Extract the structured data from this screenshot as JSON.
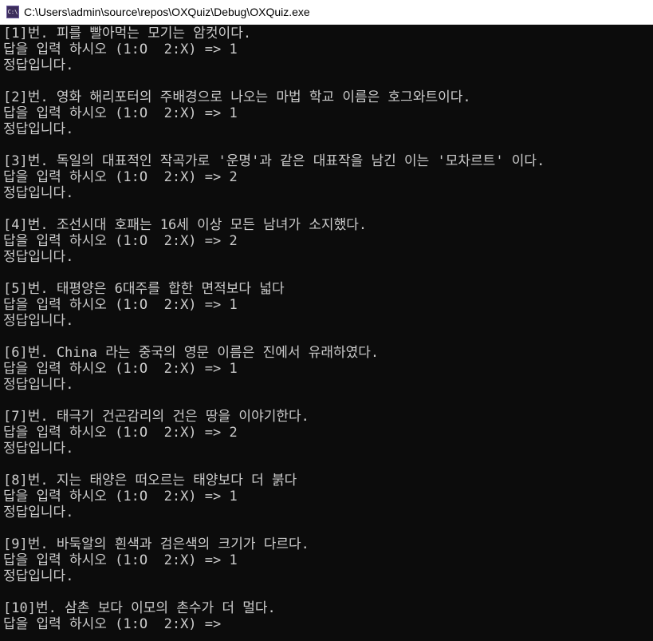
{
  "window": {
    "title": "C:\\Users\\admin\\source\\repos\\OXQuiz\\Debug\\OXQuiz.exe",
    "icon": "console-app-icon",
    "icon_glyph": "C:\\"
  },
  "console": {
    "colors": {
      "background": "#0c0c0c",
      "text": "#cccccc"
    },
    "blocks": [
      {
        "question": "[1]번. 피를 빨아먹는 모기는 암컷이다.",
        "prompt": "답을 입력 하시오 (1:O  2:X) => 1",
        "result": "정답입니다."
      },
      {
        "question": "[2]번. 영화 해리포터의 주배경으로 나오는 마법 학교 이름은 호그와트이다.",
        "prompt": "답을 입력 하시오 (1:O  2:X) => 1",
        "result": "정답입니다."
      },
      {
        "question": "[3]번. 독일의 대표적인 작곡가로 '운명'과 같은 대표작을 남긴 이는 '모차르트' 이다.",
        "prompt": "답을 입력 하시오 (1:O  2:X) => 2",
        "result": "정답입니다."
      },
      {
        "question": "[4]번. 조선시대 호패는 16세 이상 모든 남녀가 소지했다.",
        "prompt": "답을 입력 하시오 (1:O  2:X) => 2",
        "result": "정답입니다."
      },
      {
        "question": "[5]번. 태평양은 6대주를 합한 면적보다 넓다",
        "prompt": "답을 입력 하시오 (1:O  2:X) => 1",
        "result": "정답입니다."
      },
      {
        "question": "[6]번. China 라는 중국의 영문 이름은 진에서 유래하였다.",
        "prompt": "답을 입력 하시오 (1:O  2:X) => 1",
        "result": "정답입니다."
      },
      {
        "question": "[7]번. 태극기 건곤감리의 건은 땅을 이야기한다.",
        "prompt": "답을 입력 하시오 (1:O  2:X) => 2",
        "result": "정답입니다."
      },
      {
        "question": "[8]번. 지는 태양은 떠오르는 태양보다 더 붉다",
        "prompt": "답을 입력 하시오 (1:O  2:X) => 1",
        "result": "정답입니다."
      },
      {
        "question": "[9]번. 바둑알의 흰색과 검은색의 크기가 다르다.",
        "prompt": "답을 입력 하시오 (1:O  2:X) => 1",
        "result": "정답입니다."
      },
      {
        "question": "[10]번. 삼촌 보다 이모의 촌수가 더 멀다.",
        "prompt": "답을 입력 하시오 (1:O  2:X) =>"
      }
    ]
  }
}
